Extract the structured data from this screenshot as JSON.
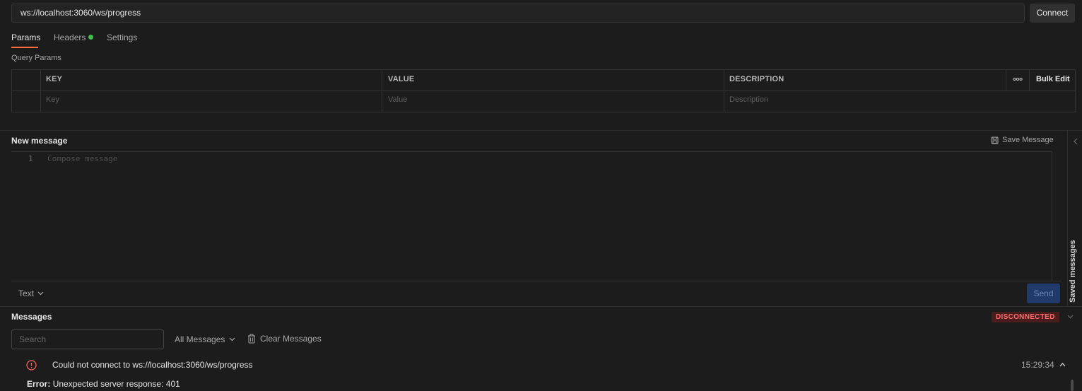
{
  "url_bar": {
    "url": "ws://localhost:3060/ws/progress",
    "connect_label": "Connect"
  },
  "tabs": [
    {
      "label": "Params",
      "active": true
    },
    {
      "label": "Headers",
      "indicator": "green-dot"
    },
    {
      "label": "Settings"
    }
  ],
  "query_params": {
    "section_label": "Query Params",
    "columns": [
      "KEY",
      "VALUE",
      "DESCRIPTION"
    ],
    "placeholders": [
      "Key",
      "Value",
      "Description"
    ],
    "bulk_edit_label": "Bulk Edit",
    "more_icon": "ellipsis-icon"
  },
  "new_message": {
    "title": "New message",
    "save_label": "Save Message",
    "line_number": "1",
    "compose_placeholder": "Compose message",
    "format_label": "Text",
    "send_label": "Send",
    "side_label": "Saved messages"
  },
  "messages": {
    "title": "Messages",
    "status": "DISCONNECTED",
    "search_placeholder": "Search",
    "filter_label": "All Messages",
    "clear_label": "Clear Messages",
    "entries": [
      {
        "text": "Could not connect to ws://localhost:3060/ws/progress",
        "time": "15:29:34",
        "detail_label": "Error:",
        "detail_text": "Unexpected server response: 401"
      }
    ]
  },
  "colors": {
    "background": "#1c1c1c",
    "accent": "#ff6c37",
    "status_error": "#ff6b6b",
    "send_button": "#1f3a6b",
    "indicator_green": "#3cc24a"
  }
}
